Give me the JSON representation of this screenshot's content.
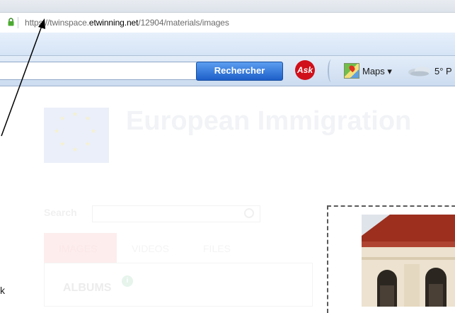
{
  "browser": {
    "url_prefix": "https://twinspace.",
    "url_domain": "etwinning.net",
    "url_path": "/12904/materials/images"
  },
  "toolbar": {
    "search_button_label": "Rechercher",
    "ask_logo_text": "Ask",
    "maps_label": "Maps ▾",
    "weather_text": "5° P"
  },
  "page": {
    "site_title": "European Immigration",
    "search_label": "Search",
    "tabs": [
      {
        "label": "IMAGES",
        "active": true
      },
      {
        "label": "VIDEOS",
        "active": false
      },
      {
        "label": "FILES",
        "active": false
      }
    ],
    "albums_heading": "ALBUMS",
    "albums_info_icon": "i"
  },
  "annotation": {
    "side_text": "k"
  },
  "colors": {
    "search_button": "#1d5fc9",
    "ask_red": "#d0101a",
    "active_tab_bg": "#fdeded",
    "toolbar_bg": "#d5e4f6"
  },
  "icons": [
    "padlock-icon",
    "ask-logo-icon",
    "google-maps-icon",
    "weather-cloud-icon",
    "search-icon",
    "info-icon",
    "eu-flag-icon"
  ]
}
